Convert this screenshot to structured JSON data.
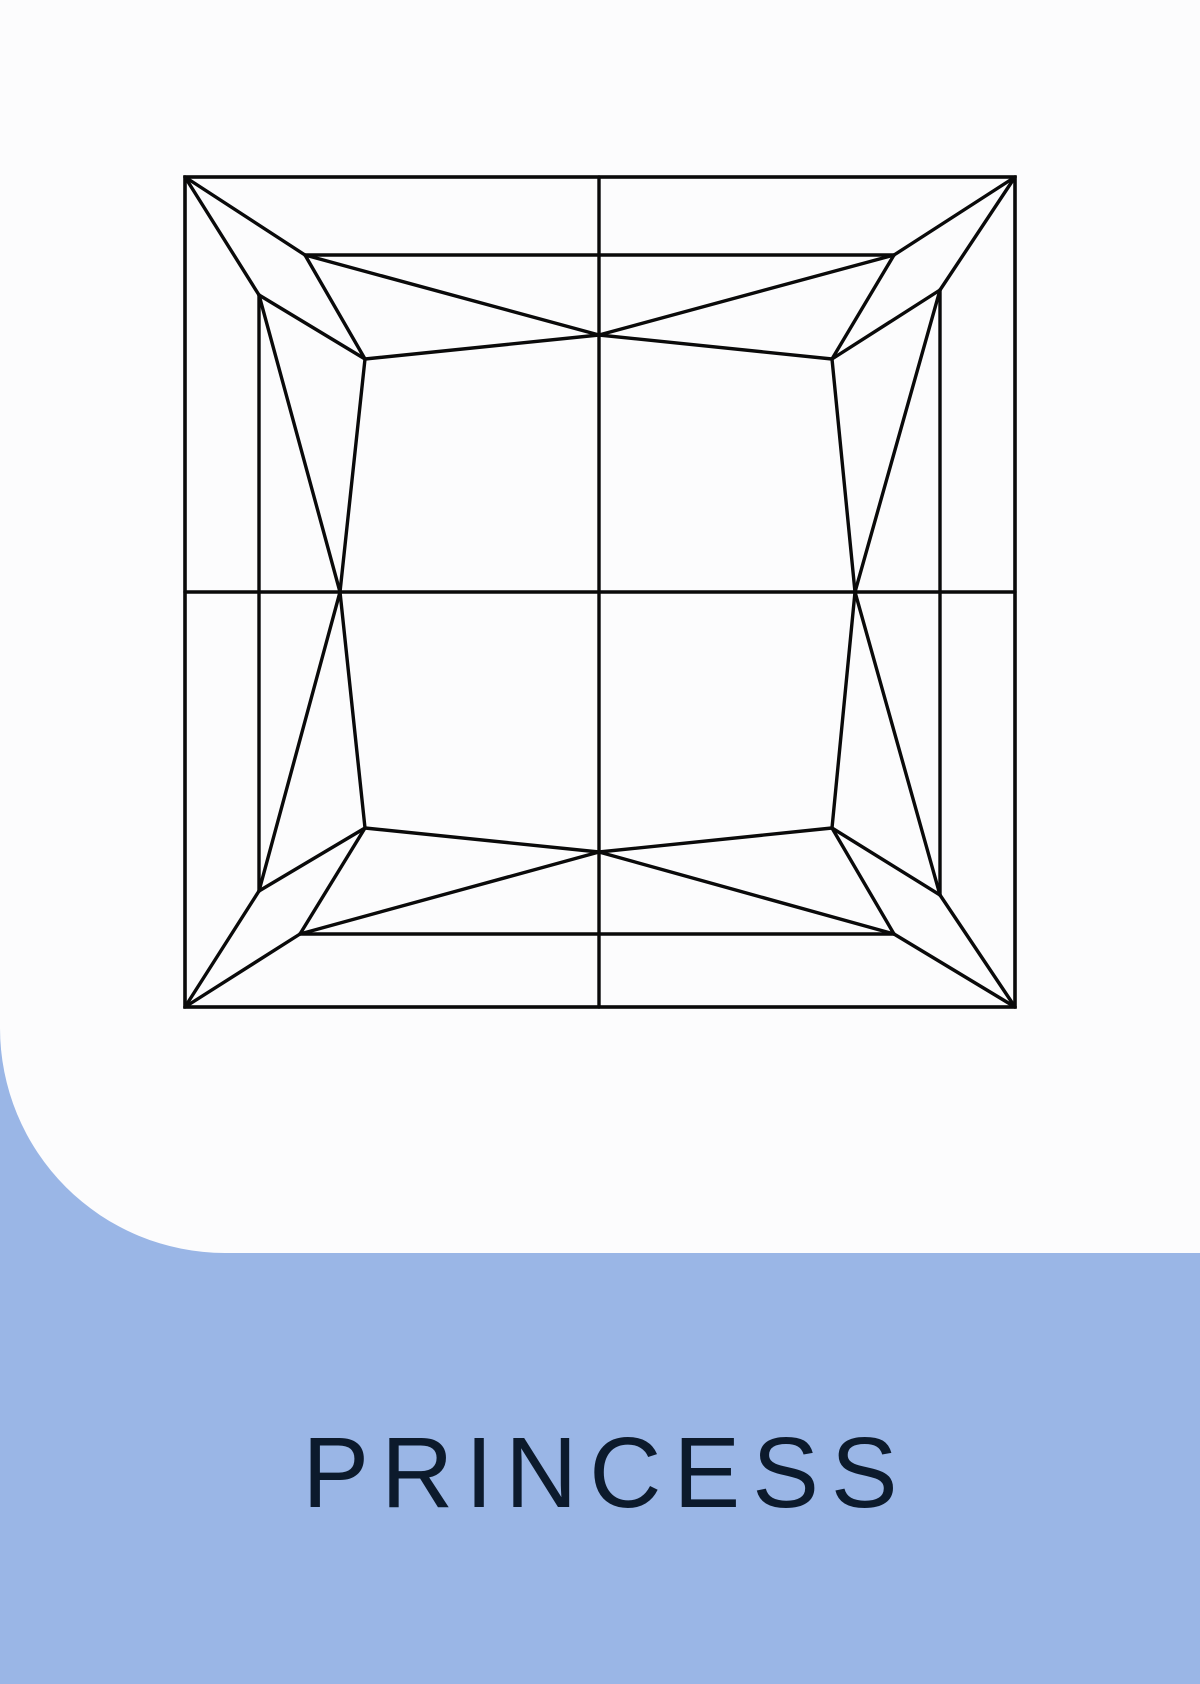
{
  "cut_name": "PRINCESS",
  "colors": {
    "background": "#9ab6e6",
    "panel": "#fcfcfd",
    "line": "#0a0a0a",
    "label": "#0c1a2c"
  },
  "icon": "princess-cut-diamond-outline"
}
